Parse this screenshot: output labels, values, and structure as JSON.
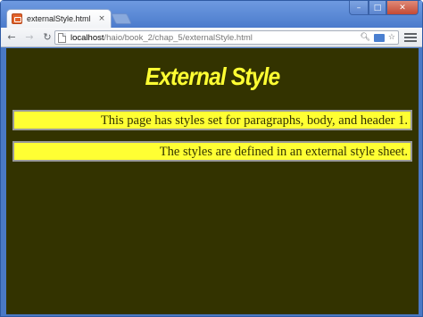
{
  "browser": {
    "tab": {
      "title": "externalStyle.html",
      "close_symbol": "×"
    },
    "window_controls": {
      "minimize": "–",
      "maximize": "□",
      "close": "✕"
    },
    "toolbar": {
      "back_icon": "back-arrow-icon",
      "forward_icon": "forward-arrow-icon",
      "reload_icon": "reload-icon",
      "url_host": "localhost",
      "url_path": "/haio/book_2/chap_5/externalStyle.html"
    }
  },
  "page": {
    "heading": "External Style",
    "paragraphs": [
      "This page has styles set for paragraphs, body, and header 1.",
      "The styles are defined in an external style sheet."
    ],
    "colors": {
      "background": "#333300",
      "heading": "#ffff33",
      "paragraph_background": "#ffff33",
      "paragraph_text": "#333300",
      "paragraph_border": "#999999"
    }
  }
}
